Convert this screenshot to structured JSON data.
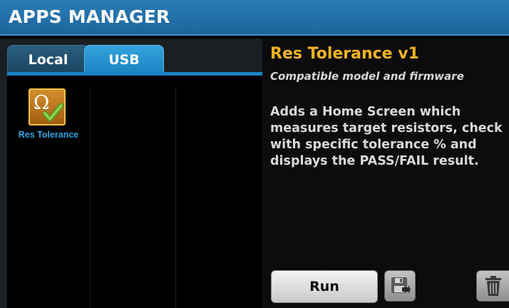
{
  "header": {
    "title": "APPS MANAGER"
  },
  "tabs": [
    {
      "label": "Local",
      "active": false
    },
    {
      "label": "USB",
      "active": true
    }
  ],
  "apps": [
    {
      "name": "Res Tolerance",
      "icon": "ohm-checkmark-icon",
      "selected": true
    }
  ],
  "details": {
    "app_title": "Res Tolerance v1",
    "compatibility": "Compatible model and firmware",
    "description": "Adds a Home Screen which\nmeasures target resistors, check\nwith specific tolerance % and\ndisplays the PASS/FAIL result."
  },
  "actions": {
    "run_label": "Run",
    "save_icon": "save-to-disk-icon",
    "delete_icon": "trash-icon"
  },
  "colors": {
    "header_bg": "#1d659b",
    "tab_active": "#1a83c2",
    "tab_inactive": "#1b4460",
    "app_title": "#f1b321",
    "app_name": "#2fa3e6",
    "text": "#d8d8d8"
  }
}
